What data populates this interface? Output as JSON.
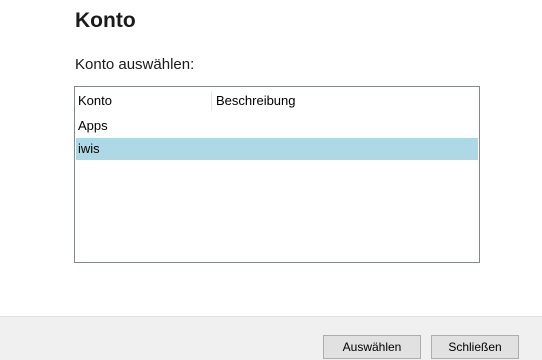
{
  "dialog": {
    "title": "Konto",
    "select_label": "Konto auswählen:"
  },
  "list": {
    "columns": [
      "Konto",
      "Beschreibung"
    ],
    "rows": [
      {
        "name": "Apps",
        "description": "",
        "selected": false
      },
      {
        "name": "iwis",
        "description": "",
        "selected": true
      }
    ]
  },
  "buttons": {
    "select_label": "Auswählen",
    "close_label": "Schließen"
  },
  "colors": {
    "selection": "#add8e6",
    "button_bar": "#f0f0f0"
  }
}
